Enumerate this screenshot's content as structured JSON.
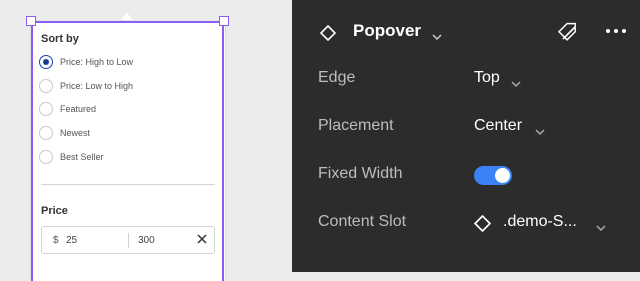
{
  "canvas": {
    "popover": {
      "sort_title": "Sort by",
      "sort_options": [
        {
          "label": "Price: High to Low",
          "selected": true
        },
        {
          "label": "Price: Low to High",
          "selected": false
        },
        {
          "label": "Featured",
          "selected": false
        },
        {
          "label": "Newest",
          "selected": false
        },
        {
          "label": "Best Seller",
          "selected": false
        }
      ],
      "price_title": "Price",
      "price": {
        "currency": "$",
        "min": "25",
        "max": "300"
      }
    },
    "selection_color": "#8b5cf6"
  },
  "inspector": {
    "component_name": "Popover",
    "properties": [
      {
        "label": "Edge",
        "value": "Top"
      },
      {
        "label": "Placement",
        "value": "Center"
      },
      {
        "label": "Fixed Width",
        "toggle_on": true
      },
      {
        "label": "Content Slot",
        "value": ".demo-S..."
      }
    ],
    "toggle_color": "#3b82f6",
    "icons": [
      "diamond-icon",
      "chevron-down-icon",
      "detach-instance-icon",
      "more-icon"
    ]
  }
}
